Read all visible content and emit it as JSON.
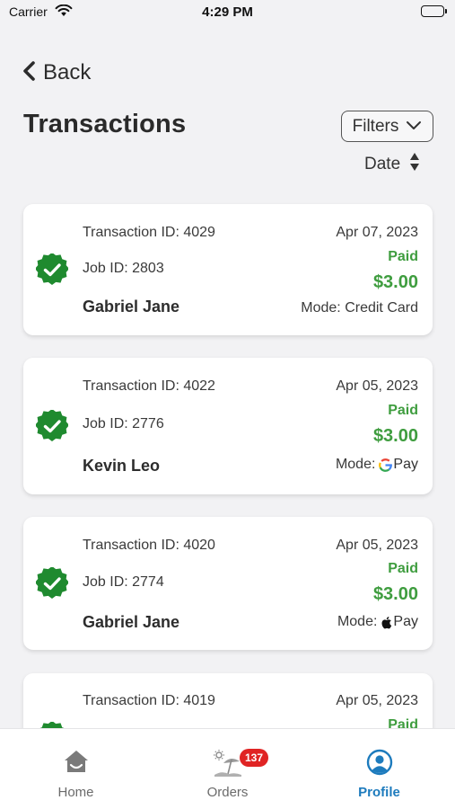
{
  "status_bar": {
    "carrier": "Carrier",
    "time": "4:29 PM"
  },
  "header": {
    "back_label": "Back",
    "title": "Transactions",
    "filters_label": "Filters",
    "sort_label": "Date"
  },
  "colors": {
    "paid_green": "#3f9d3f",
    "badge_green": "#1f8a2f",
    "accent_blue": "#1d7bbd",
    "badge_red": "#e02424"
  },
  "transactions": [
    {
      "transaction_id": "Transaction ID: 4029",
      "job_id": "Job ID: 2803",
      "name": "Gabriel Jane",
      "date": "Apr 07, 2023",
      "status": "Paid",
      "amount": "$3.00",
      "mode_label": "Mode: Credit Card",
      "mode_icon": ""
    },
    {
      "transaction_id": "Transaction ID: 4022",
      "job_id": "Job ID: 2776",
      "name": "Kevin Leo",
      "date": "Apr 05, 2023",
      "status": "Paid",
      "amount": "$3.00",
      "mode_label": "Mode:",
      "mode_icon": "google-pay-icon",
      "pay_word": "Pay"
    },
    {
      "transaction_id": "Transaction ID: 4020",
      "job_id": "Job ID: 2774",
      "name": "Gabriel Jane",
      "date": "Apr 05, 2023",
      "status": "Paid",
      "amount": "$3.00",
      "mode_label": "Mode:",
      "mode_icon": "apple-pay-icon",
      "pay_word": "Pay"
    },
    {
      "transaction_id": "Transaction ID: 4019",
      "date": "Apr 05, 2023",
      "status": "Paid"
    }
  ],
  "tab_bar": {
    "home": "Home",
    "orders": "Orders",
    "orders_badge": "137",
    "profile": "Profile"
  }
}
